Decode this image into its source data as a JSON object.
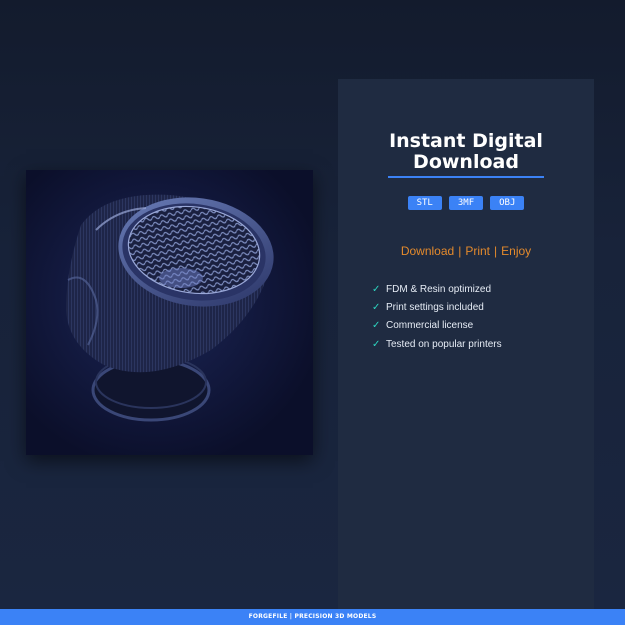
{
  "panel": {
    "title_line1": "Instant Digital",
    "title_line2": "Download",
    "formats": [
      "STL",
      "3MF",
      "OBJ"
    ],
    "tagline": [
      "Download",
      "Print",
      "Enjoy"
    ],
    "tagline_separator": "|",
    "features": [
      "FDM & Resin optimized",
      "Print settings included",
      "Commercial license",
      "Tested on popular printers"
    ],
    "check_icon": "check-icon"
  },
  "footer": {
    "text": "FORGEFILE  |  PRECISION 3D MODELS"
  },
  "colors": {
    "accent_blue": "#3b82f6",
    "accent_orange": "#e48a2c",
    "check_teal": "#2dd4bf",
    "panel_bg": "#1f2b41",
    "page_bg": "#18233a"
  }
}
